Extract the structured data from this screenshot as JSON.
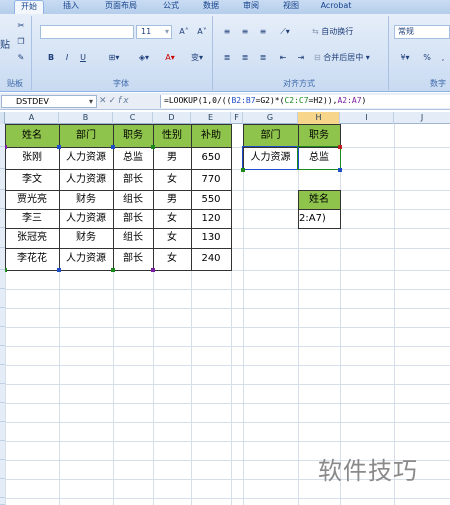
{
  "ribbon": {
    "tabs": [
      "开始",
      "插入",
      "页面布局",
      "公式",
      "数据",
      "审阅",
      "视图",
      "Acrobat"
    ],
    "groups": {
      "clipboard": "贴板",
      "font": "字体",
      "alignment": "对齐方式",
      "number": "数字"
    },
    "font_size": "11",
    "wrap_text": "自动换行",
    "merge_center": "合并后居中",
    "number_format": "常规",
    "paste": "贴",
    "percent": "%"
  },
  "formula_bar": {
    "name_box": "DSTDEV",
    "fx": "fx",
    "formula_parts": [
      "=LOOKUP(1,0/((",
      "B2:B7",
      "=G2)*(",
      "C2:C7",
      "=H2)),",
      "A2:A7",
      ")"
    ]
  },
  "columns": [
    "A",
    "B",
    "C",
    "D",
    "E",
    "F",
    "G",
    "H",
    "I",
    "J"
  ],
  "rows": [
    "1",
    "2",
    "3",
    "4",
    "5",
    "6",
    "7",
    "8",
    "9",
    "10",
    "11",
    "12",
    "13",
    "14",
    "15",
    "16",
    "17",
    "18",
    "19",
    "20",
    "21",
    "22",
    "23",
    "24",
    "25"
  ],
  "table": {
    "headers": [
      "姓名",
      "部门",
      "职务",
      "性别",
      "补助"
    ],
    "rows": [
      [
        "张刚",
        "人力资源",
        "总监",
        "男",
        "650"
      ],
      [
        "李文",
        "人力资源",
        "部长",
        "女",
        "770"
      ],
      [
        "贾光亮",
        "财务",
        "组长",
        "男",
        "550"
      ],
      [
        "李三",
        "人力资源",
        "部长",
        "女",
        "120"
      ],
      [
        "张冠亮",
        "财务",
        "组长",
        "女",
        "130"
      ],
      [
        "李花花",
        "人力资源",
        "部长",
        "女",
        "240"
      ]
    ]
  },
  "lookup": {
    "headers": [
      "部门",
      "职务"
    ],
    "values": [
      "人力资源",
      "总监"
    ],
    "result_header": "姓名",
    "result_value": "2:A7)"
  },
  "watermark": "软件技巧",
  "colors": {
    "header_fill": "#8fc44c",
    "ribbon": "#d5e3f5"
  }
}
